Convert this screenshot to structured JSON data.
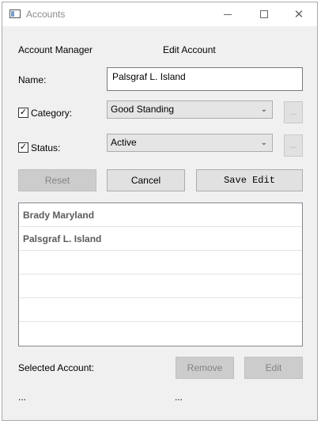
{
  "window": {
    "title": "Accounts"
  },
  "header": {
    "left_label": "Account Manager",
    "mode_label": "Edit Account"
  },
  "form": {
    "name_label": "Name:",
    "name_value": "Palsgraf L. Island",
    "category_label": "Category:",
    "category_checked": true,
    "category_value": "Good Standing",
    "status_label": "Status:",
    "status_checked": true,
    "status_value": "Active",
    "ellipsis": "..."
  },
  "actions": {
    "reset": "Reset",
    "cancel": "Cancel",
    "save_edit": "Save Edit"
  },
  "accounts": [
    "Brady Maryland",
    "Palsgraf L. Island",
    "",
    "",
    "",
    ""
  ],
  "footer": {
    "selected_label": "Selected Account:",
    "remove": "Remove",
    "edit": "Edit",
    "left_ellipsis": "...",
    "right_ellipsis": "..."
  },
  "glyphs": {
    "check": "✓",
    "chevron": "⌄",
    "close": "✕"
  }
}
